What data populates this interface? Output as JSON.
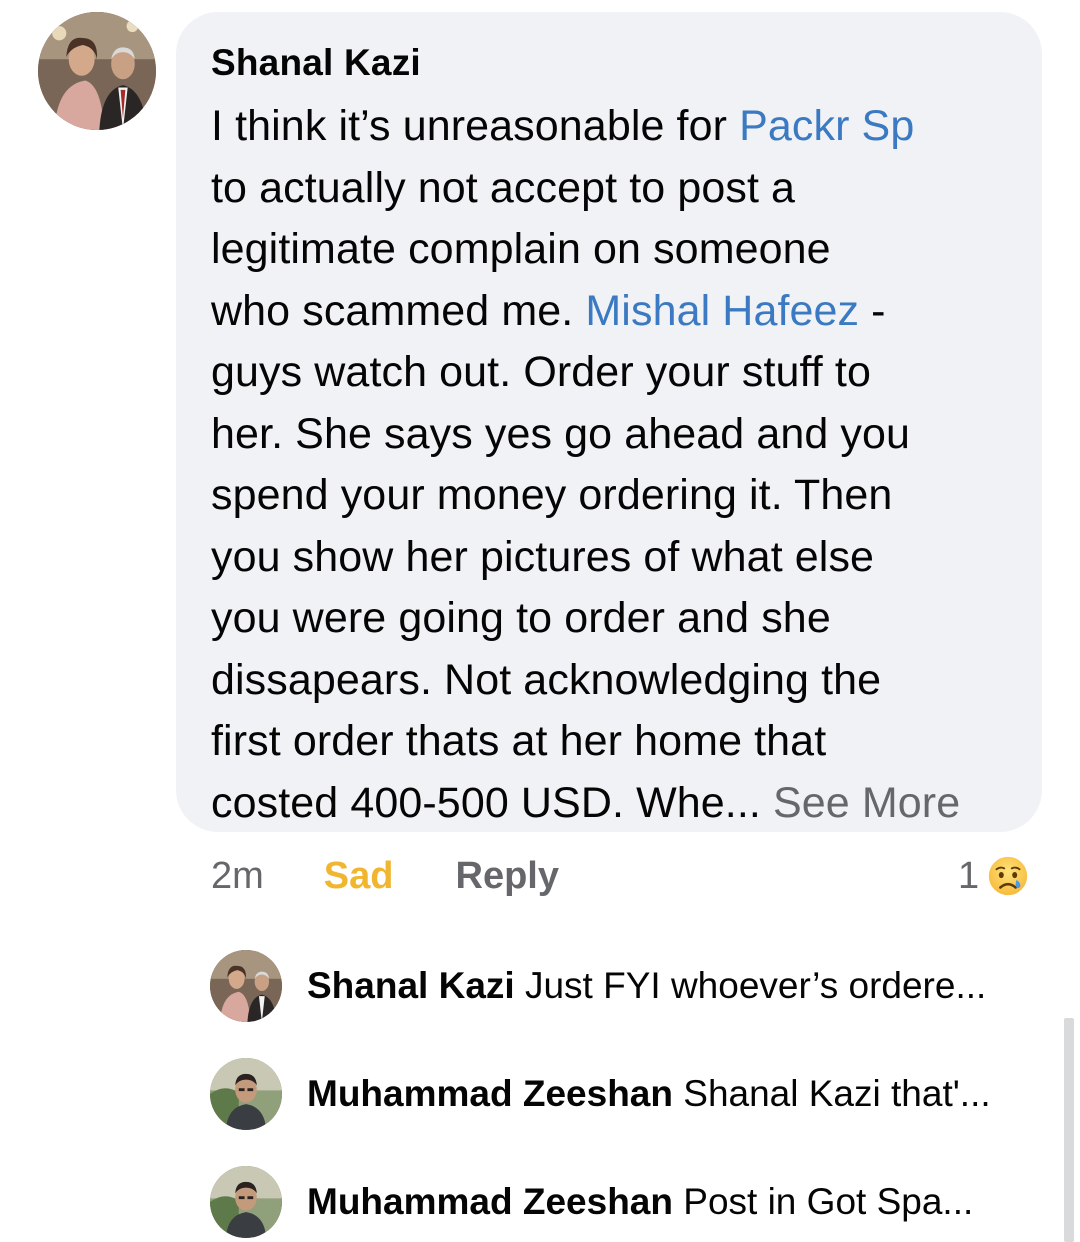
{
  "comment": {
    "author": "Shanal Kazi",
    "lines": [
      {
        "parts": [
          {
            "t": "I think it’s unreasonable for "
          },
          {
            "t": "Packr Sp",
            "mention": true
          }
        ]
      },
      {
        "parts": [
          {
            "t": "to actually not accept to post a"
          }
        ]
      },
      {
        "parts": [
          {
            "t": "legitimate complain on someone"
          }
        ]
      },
      {
        "parts": [
          {
            "t": "who scammed me. "
          },
          {
            "t": "Mishal Hafeez",
            "mention": true
          },
          {
            "t": " -"
          }
        ]
      },
      {
        "parts": [
          {
            "t": "guys watch out. Order your stuff to"
          }
        ]
      },
      {
        "parts": [
          {
            "t": "her. She says yes go ahead and you"
          }
        ]
      },
      {
        "parts": [
          {
            "t": "spend your money ordering it. Then"
          }
        ]
      },
      {
        "parts": [
          {
            "t": "you show her pictures of what else"
          }
        ]
      },
      {
        "parts": [
          {
            "t": "you were going to order and she"
          }
        ]
      },
      {
        "parts": [
          {
            "t": "dissapears. Not acknowledging the"
          }
        ]
      },
      {
        "parts": [
          {
            "t": "first order thats at her home that"
          }
        ]
      },
      {
        "parts": [
          {
            "t": "costed 400-500 USD. Whe... "
          },
          {
            "t": "See More",
            "seeMore": true
          }
        ]
      }
    ],
    "time": "2m",
    "reaction_label": "Sad",
    "reply_label": "Reply",
    "reaction_count": "1",
    "reaction_icon": "sad-face-icon"
  },
  "replies": [
    {
      "author": "Shanal Kazi",
      "text": "Just FYI whoever’s ordere..."
    },
    {
      "author": "Muhammad Zeeshan",
      "text": "Shanal Kazi that'..."
    },
    {
      "author": "Muhammad Zeeshan",
      "text": "Post in Got Spa..."
    }
  ],
  "colors": {
    "bubble": "#f0f2f5",
    "mention": "#3b7ac2",
    "sad": "#f0b630",
    "secondary": "#65676b"
  }
}
